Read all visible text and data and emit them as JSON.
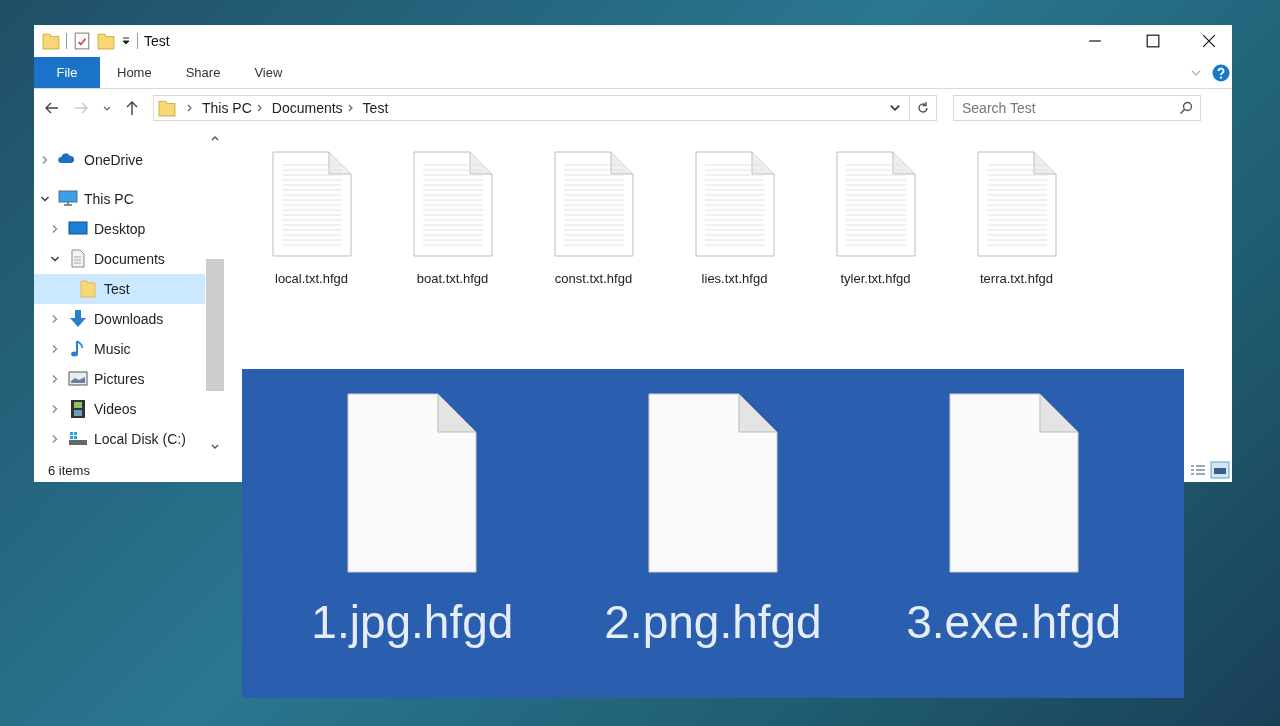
{
  "window": {
    "title": "Test"
  },
  "ribbon": {
    "tabs": [
      {
        "label": "File",
        "kind": "menu"
      },
      {
        "label": "Home",
        "kind": "tab"
      },
      {
        "label": "Share",
        "kind": "tab"
      },
      {
        "label": "View",
        "kind": "tab"
      }
    ]
  },
  "address_bar": {
    "path": [
      "This PC",
      "Documents",
      "Test"
    ]
  },
  "search": {
    "placeholder": "Search Test"
  },
  "nav_tree": [
    {
      "label": "OneDrive",
      "kind": "cloud",
      "expanded": false,
      "selected": false
    },
    {
      "label": "This PC",
      "kind": "computer",
      "expanded": true,
      "selected": false,
      "children": [
        {
          "label": "Desktop",
          "kind": "desktop",
          "expanded": false,
          "selected": false
        },
        {
          "label": "Documents",
          "kind": "documents",
          "expanded": true,
          "selected": false,
          "children": [
            {
              "label": "Test",
              "kind": "folder",
              "selected": true
            }
          ]
        },
        {
          "label": "Downloads",
          "kind": "downloads",
          "expanded": false,
          "selected": false
        },
        {
          "label": "Music",
          "kind": "music",
          "expanded": false,
          "selected": false
        },
        {
          "label": "Pictures",
          "kind": "pictures",
          "expanded": false,
          "selected": false
        },
        {
          "label": "Videos",
          "kind": "videos",
          "expanded": false,
          "selected": false
        },
        {
          "label": "Local Disk (C:)",
          "kind": "drive",
          "expanded": false,
          "selected": false
        }
      ]
    }
  ],
  "files": [
    {
      "name": "local.txt.hfgd"
    },
    {
      "name": "boat.txt.hfgd"
    },
    {
      "name": "const.txt.hfgd"
    },
    {
      "name": "lies.txt.hfgd"
    },
    {
      "name": "tyler.txt.hfgd"
    },
    {
      "name": "terra.txt.hfgd"
    }
  ],
  "status_bar": {
    "item_count": "6 items"
  },
  "zoomed_files": [
    {
      "name": "1.jpg.hfgd"
    },
    {
      "name": "2.png.hfgd"
    },
    {
      "name": "3.exe.hfgd"
    }
  ]
}
